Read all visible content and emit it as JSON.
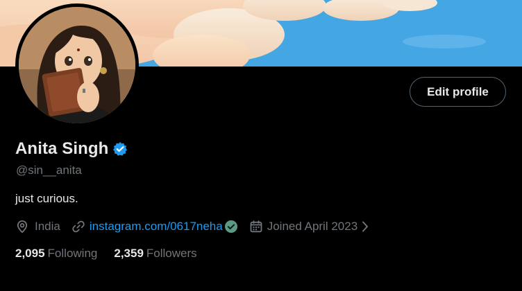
{
  "profile": {
    "display_name": "Anita Singh",
    "handle": "@sin__anita",
    "bio": "just curious.",
    "edit_button_label": "Edit profile",
    "location": "India",
    "website": "instagram.com/0617neha",
    "joined": "Joined April 2023",
    "following_count": "2,095",
    "following_label": "Following",
    "followers_count": "2,359",
    "followers_label": "Followers"
  },
  "colors": {
    "background": "#000000",
    "primary_text": "#e7e9ea",
    "secondary_text": "#71767b",
    "link": "#1d9bf0",
    "verified_badge": "#1d9bf0",
    "website_check": "#5a9b84",
    "button_border": "#536471"
  },
  "icons": {
    "verified": "verified-badge-icon",
    "location": "location-pin-icon",
    "link": "link-icon",
    "link_check": "check-badge-icon",
    "calendar": "calendar-icon",
    "chevron": "chevron-right-icon"
  }
}
